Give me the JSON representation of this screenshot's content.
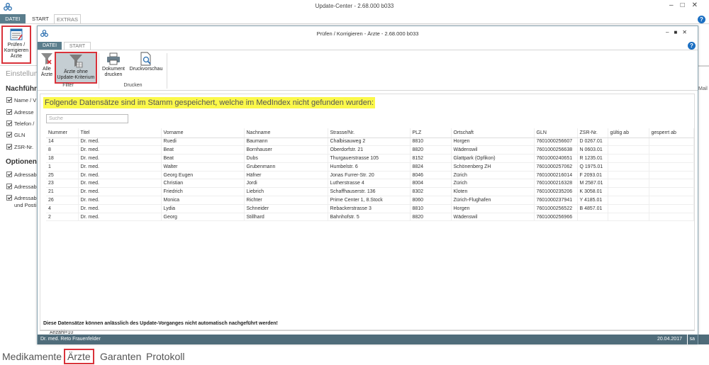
{
  "outer": {
    "title": "Update-Center - 2.68.000 b033",
    "tabs": [
      "DATEI",
      "START",
      "EXTRAS"
    ],
    "ribbon_button": {
      "line1": "Prüfen /",
      "line2": "Korrigieren",
      "line3": "Ärzte"
    },
    "left_panel": {
      "heading_light": "Einstellun",
      "heading1": "Nachführ",
      "checks": [
        "Name / V",
        "Adresse",
        "Telefon /",
        "GLN",
        "ZSR-Nr."
      ],
      "heading2": "Optionen",
      "options": [
        "Adressabc",
        "Adressabc",
        "Adressabc",
        "und Posti"
      ]
    },
    "right_fragment": "Mail",
    "bottom_tabs": [
      "Medikamente",
      "Ärzte",
      "Garanten",
      "Protokoll"
    ]
  },
  "dialog": {
    "title": "Prüfen / Korrigieren - Ärzte - 2.68.000 b033",
    "tabs": [
      "DATEI",
      "START"
    ],
    "ribbon": {
      "alle_aerzte": {
        "line1": "Alle",
        "line2": "Ärzte"
      },
      "ohne_kriterium": {
        "line1": "Ärzte ohne",
        "line2": "Update-Kriterium"
      },
      "filter_label": "Filter",
      "dokument_drucken": {
        "line1": "Dokument",
        "line2": "drucken"
      },
      "druckvorschau": {
        "line1": "Druckvorschau"
      },
      "drucken_label": "Drucken"
    },
    "headline": "Folgende Datensätze sind im Stamm gespeichert, welche im MedIndex nicht gefunden wurden:",
    "search_placeholder": "Suche",
    "columns": [
      "Nummer",
      "Titel",
      "Vorname",
      "Nachname",
      "Strasse/Nr.",
      "PLZ",
      "Ortschaft",
      "GLN",
      "ZSR-Nr.",
      "gültig ab",
      "gesperrt ab"
    ],
    "rows": [
      [
        "14",
        "Dr. med.",
        "Ruedi",
        "Baumann",
        "Chalbisauweg 2",
        "8810",
        "Horgen",
        "7601000256607",
        "D 0267.01",
        "",
        ""
      ],
      [
        "8",
        "Dr. med.",
        "Beat",
        "Bornhauser",
        "Oberdorfstr. 21",
        "8820",
        "Wädenswil",
        "7601000256638",
        "N 0603.01",
        "",
        ""
      ],
      [
        "18",
        "Dr. med.",
        "Beat",
        "Dubs",
        "Thurgauerstrasse 105",
        "8152",
        "Glattpark (Opfikon)",
        "7601000240651",
        "R 1235.01",
        "",
        ""
      ],
      [
        "1",
        "Dr. med.",
        "Walter",
        "Grubenmann",
        "Humbelstr. 6",
        "8824",
        "Schönenberg ZH",
        "7601000257062",
        "Q 1975.01",
        "",
        ""
      ],
      [
        "25",
        "Dr. med.",
        "Georg Eugen",
        "Häfner",
        "Jonas Furrer-Str. 20",
        "8046",
        "Zürich",
        "7601000216014",
        "F 2093.01",
        "",
        ""
      ],
      [
        "23",
        "Dr. med.",
        "Christian",
        "Jordi",
        "Lutherstrasse 4",
        "8004",
        "Zürich",
        "7601000216328",
        "M 2587.01",
        "",
        ""
      ],
      [
        "21",
        "Dr. med.",
        "Friedrich",
        "Liebrich",
        "Schaffhauserstr. 136",
        "8302",
        "Kloten",
        "7601000235206",
        "K 3058.01",
        "",
        ""
      ],
      [
        "26",
        "Dr. med.",
        "Monica",
        "Richter",
        "Prime Center 1, 8.Stock",
        "8060",
        "Zürich-Flughafen",
        "7601000237941",
        "Y 4185.01",
        "",
        ""
      ],
      [
        "4",
        "Dr. med.",
        "Lydia",
        "Schneider",
        "Rebackerstrasse 3",
        "8810",
        "Horgen",
        "7601000256522",
        "B 4857.01",
        "",
        ""
      ],
      [
        "2",
        "Dr. med.",
        "Georg",
        "Stillhard",
        "Bahnhofstr. 5",
        "8820",
        "Wädenswil",
        "7601000256966",
        "",
        "",
        ""
      ]
    ],
    "count": "Anzahl=10",
    "note": "Diese Datensätze können anlässlich des Update-Vorganges nicht automatisch nachgeführt werden!",
    "status": {
      "user": "Dr. med. Reto Frauenfelder",
      "date": "20.04.2017",
      "login": "sa"
    }
  },
  "colors": {
    "accent": "#5a7d8c",
    "status_bar": "#4f6c7a",
    "highlight": "#fbf84a",
    "annotation_red": "#d9323a",
    "help_blue": "#1b6fc2"
  },
  "icons": [
    "app-logo-icon",
    "report-icon",
    "filter-remove-icon",
    "filter-icon",
    "printer-icon",
    "print-preview-icon",
    "help-icon"
  ]
}
